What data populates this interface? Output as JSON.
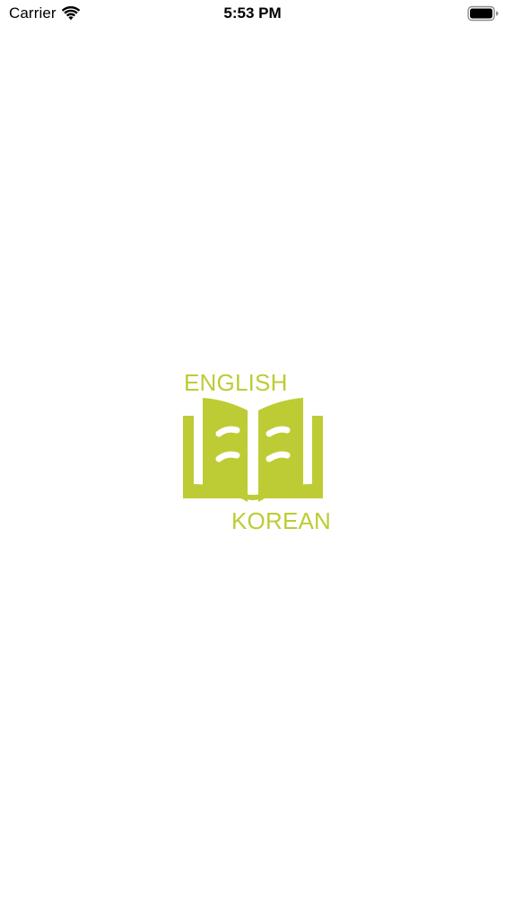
{
  "status_bar": {
    "carrier": "Carrier",
    "time": "5:53 PM",
    "icons": {
      "signal": "wifi-icon",
      "battery": "battery-icon"
    }
  },
  "splash": {
    "top_word": "ENGLISH",
    "bottom_word": "KOREAN",
    "logo_icon": "open-book-icon",
    "brand_color": "#bdcc34"
  }
}
